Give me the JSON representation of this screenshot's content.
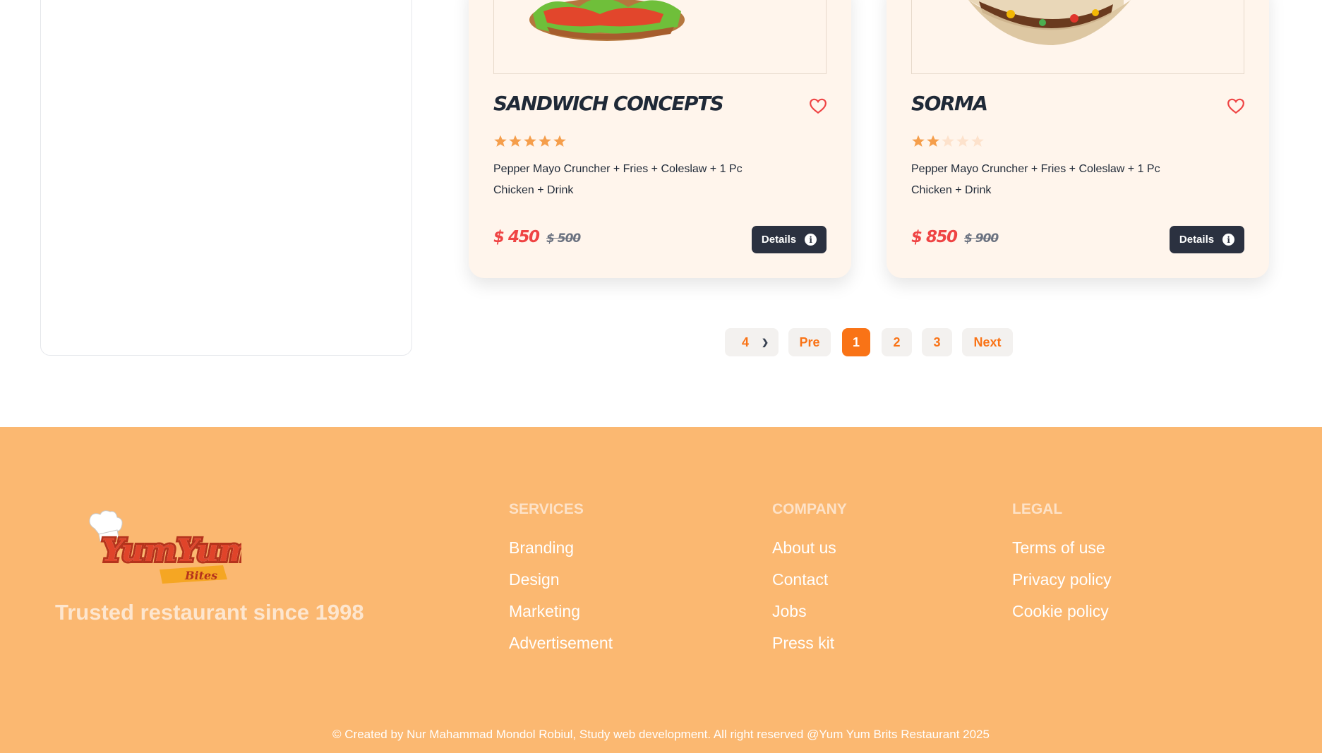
{
  "products": [
    {
      "name": "Sandwich Concepts",
      "rating": 5,
      "rating_max": 5,
      "description": "Pepper Mayo Cruncher + Fries + Coleslaw + 1 Pc Chicken + Drink",
      "price": "$ 450",
      "old_price": "$ 500",
      "details_label": "Details"
    },
    {
      "name": "Sorma",
      "rating": 2,
      "rating_max": 5,
      "description": "Pepper Mayo Cruncher + Fries + Coleslaw + 1 Pc Chicken + Drink",
      "price": "$ 850",
      "old_price": "$ 900",
      "details_label": "Details"
    }
  ],
  "pagination": {
    "per_page": "4",
    "prev_label": "Pre",
    "pages": [
      "1",
      "2",
      "3"
    ],
    "active_page": "1",
    "next_label": "Next"
  },
  "footer": {
    "logo_text": "YumYum",
    "logo_subtext": "Bites",
    "tagline": "Trusted restaurant since 1998",
    "columns": [
      {
        "heading": "Services",
        "links": [
          "Branding",
          "Design",
          "Marketing",
          "Advertisement"
        ]
      },
      {
        "heading": "Company",
        "links": [
          "About us",
          "Contact",
          "Jobs",
          "Press kit"
        ]
      },
      {
        "heading": "Legal",
        "links": [
          "Terms of use",
          "Privacy policy",
          "Cookie policy"
        ]
      }
    ],
    "copyright": "© Created by Nur Mahammad Mondol Robiul, Study web development. All right reserved @Yum Yum Brits Restaurant 2025"
  },
  "colors": {
    "accent": "#f97316",
    "price": "#ef4444",
    "card_bg": "#fff5ec",
    "footer_bg": "#fbb871",
    "button_dark": "#2b3140",
    "star_filled": "#f59e4b",
    "star_empty": "#fde2cc"
  },
  "icons": {
    "wishlist": "heart-icon",
    "details": "info-icon",
    "select": "chevron-down-icon"
  }
}
